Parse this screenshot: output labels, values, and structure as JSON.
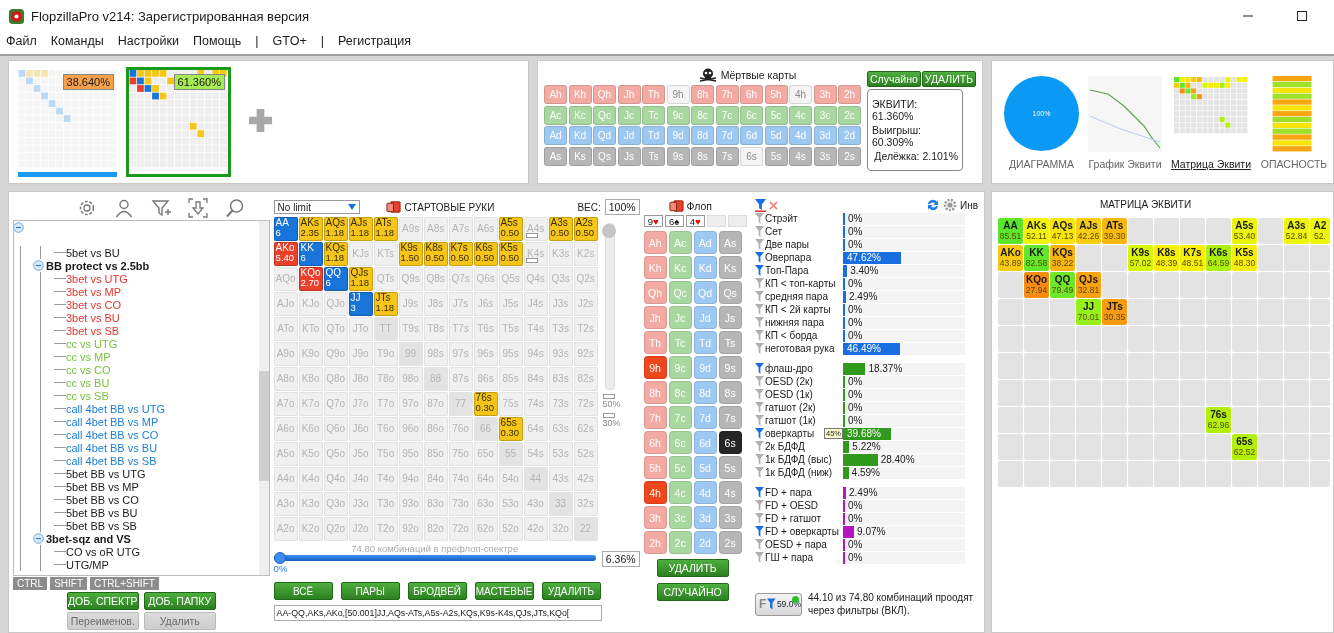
{
  "window": {
    "title": "FlopzillaPro v214: Зарегистрированная версия"
  },
  "menu": [
    "Файл",
    "Команды",
    "Настройки",
    "Помощь",
    "|",
    "GTO+",
    "|",
    "Регистрация"
  ],
  "ranges": [
    {
      "percent": "38.640%",
      "selected": false,
      "color": "#f7a04a"
    },
    {
      "percent": "61.360%",
      "selected": true,
      "color": "#a6ea55"
    }
  ],
  "dead_cards": {
    "title": "Мёртвые карты",
    "buttons": [
      "Случайно",
      "УДАЛИТЬ"
    ],
    "rows": [
      [
        {
          "label": "Ah",
          "disabled": false
        },
        {
          "label": "Kh",
          "disabled": false
        },
        {
          "label": "Qh",
          "disabled": false
        },
        {
          "label": "Jh",
          "disabled": false
        },
        {
          "label": "Th",
          "disabled": false
        },
        {
          "label": "9h",
          "disabled": true
        },
        {
          "label": "8h",
          "disabled": false
        },
        {
          "label": "7h",
          "disabled": false
        },
        {
          "label": "6h",
          "disabled": false
        },
        {
          "label": "5h",
          "disabled": false
        },
        {
          "label": "4h",
          "disabled": true
        },
        {
          "label": "3h",
          "disabled": false
        },
        {
          "label": "2h",
          "disabled": false
        }
      ],
      [
        {
          "label": "Ac",
          "disabled": false
        },
        {
          "label": "Kc",
          "disabled": false
        },
        {
          "label": "Qc",
          "disabled": false
        },
        {
          "label": "Jc",
          "disabled": false
        },
        {
          "label": "Tc",
          "disabled": false
        },
        {
          "label": "9c",
          "disabled": false
        },
        {
          "label": "8c",
          "disabled": false
        },
        {
          "label": "7c",
          "disabled": false
        },
        {
          "label": "6c",
          "disabled": false
        },
        {
          "label": "5c",
          "disabled": false
        },
        {
          "label": "4c",
          "disabled": false
        },
        {
          "label": "3c",
          "disabled": false
        },
        {
          "label": "2c",
          "disabled": false
        }
      ],
      [
        {
          "label": "Ad",
          "disabled": false
        },
        {
          "label": "Kd",
          "disabled": false
        },
        {
          "label": "Qd",
          "disabled": false
        },
        {
          "label": "Jd",
          "disabled": false
        },
        {
          "label": "Td",
          "disabled": false
        },
        {
          "label": "9d",
          "disabled": false
        },
        {
          "label": "8d",
          "disabled": false
        },
        {
          "label": "7d",
          "disabled": false
        },
        {
          "label": "6d",
          "disabled": false
        },
        {
          "label": "5d",
          "disabled": false
        },
        {
          "label": "4d",
          "disabled": false
        },
        {
          "label": "3d",
          "disabled": false
        },
        {
          "label": "2d",
          "disabled": false
        }
      ],
      [
        {
          "label": "As",
          "disabled": false
        },
        {
          "label": "Ks",
          "disabled": false
        },
        {
          "label": "Qs",
          "disabled": false
        },
        {
          "label": "Js",
          "disabled": false
        },
        {
          "label": "Ts",
          "disabled": false
        },
        {
          "label": "9s",
          "disabled": false
        },
        {
          "label": "8s",
          "disabled": false
        },
        {
          "label": "7s",
          "disabled": false
        },
        {
          "label": "6s",
          "disabled": true
        },
        {
          "label": "5s",
          "disabled": false
        },
        {
          "label": "4s",
          "disabled": false
        },
        {
          "label": "3s",
          "disabled": false
        },
        {
          "label": "2s",
          "disabled": false
        }
      ]
    ],
    "equity": [
      "ЭКВИТИ: 61.360%",
      "Выигрыш: 60.309%",
      "Делёжка: 2.101%"
    ]
  },
  "views": [
    {
      "kind": "pie",
      "label": "ДИАГРАММА",
      "text": "100%",
      "selected": false
    },
    {
      "kind": "line",
      "label": "График Эквити",
      "selected": false
    },
    {
      "kind": "matrix",
      "label": "Матрица Эквити",
      "selected": true
    },
    {
      "kind": "heat",
      "label": "ОПАСНОСТЬ",
      "selected": false
    }
  ],
  "tree": {
    "items": [
      {
        "expanded": true,
        "children": [
          {
            "expanded": true,
            "children": [
              {
                "label": "5bet vs BU",
                "color": "#1a1a1a"
              }
            ]
          },
          {
            "label": "BB protect vs 2.5bb",
            "expanded": true,
            "children": [
              {
                "label": "3bet vs UTG",
                "color": "#e8352e"
              },
              {
                "label": "3bet vs MP",
                "color": "#e8352e"
              },
              {
                "label": "3bet vs CO",
                "color": "#e8352e"
              },
              {
                "label": "3bet vs BU",
                "color": "#e8352e"
              },
              {
                "label": "3bet vs SB",
                "color": "#e8352e"
              },
              {
                "label": "cc vs UTG",
                "color": "#78c13a"
              },
              {
                "label": "cc vs MP",
                "color": "#78c13a"
              },
              {
                "label": "cc vs CO",
                "color": "#78c13a"
              },
              {
                "label": "cc vs BU",
                "color": "#78c13a"
              },
              {
                "label": "cc vs SB",
                "color": "#78c13a"
              },
              {
                "label": "call 4bet BB vs UTG",
                "color": "#1c7fd6"
              },
              {
                "label": "call 4bet BB vs MP",
                "color": "#1c7fd6"
              },
              {
                "label": "call 4bet BB vs CO",
                "color": "#1c7fd6"
              },
              {
                "label": "call 4bet BB vs BU",
                "color": "#1c7fd6"
              },
              {
                "label": "call 4bet BB vs SB",
                "color": "#1c7fd6"
              },
              {
                "label": "5bet BB vs UTG",
                "color": "#1a1a1a"
              },
              {
                "label": "5bet BB vs MP",
                "color": "#1a1a1a"
              },
              {
                "label": "5bet BB vs CO",
                "color": "#1a1a1a"
              },
              {
                "label": "5bet BB vs BU",
                "color": "#1a1a1a"
              },
              {
                "label": "5bet BB vs SB",
                "color": "#1a1a1a"
              }
            ]
          },
          {
            "label": "3bet-sqz and VS",
            "expanded": true,
            "children": [
              {
                "label": "CO vs oR UTG",
                "color": "#1a1a1a"
              },
              {
                "label": "UTG/MP",
                "color": "#1a1a1a"
              }
            ]
          }
        ]
      }
    ],
    "modifier_keys": [
      "CTRL",
      "SHIFT",
      "CTRL+SHIFT"
    ],
    "buttons": [
      {
        "label": "ДОБ. СПЕКТР",
        "disabled": false
      },
      {
        "label": "ДОБ. ПАПКУ",
        "disabled": false
      },
      {
        "label": "Переименов.",
        "disabled": true
      },
      {
        "label": "Удалить",
        "disabled": true
      }
    ]
  },
  "range_editor": {
    "game_type": "No limit",
    "title": "СТАРТОВЫЕ РУКИ",
    "weight_label": "ВЕС:",
    "weight": "100%",
    "weight_slider": {
      "level": 1
    },
    "marks": [
      "50%",
      "30%"
    ],
    "rows": [
      [
        {
          "hand": "AA",
          "weight": "6",
          "color": "#1874d8"
        },
        {
          "hand": "AKs",
          "weight": "2.35",
          "color": "#f5c518"
        },
        {
          "hand": "AQs",
          "weight": "1.18",
          "color": "#f5c518"
        },
        {
          "hand": "AJs",
          "weight": "1.18",
          "color": "#f5c518"
        },
        {
          "hand": "ATs",
          "weight": "1.18",
          "color": "#f5c518"
        },
        "A9s",
        "A8s",
        "A7s",
        "A6s",
        {
          "hand": "A5s",
          "weight": "0.50",
          "color": "#f5c518"
        },
        {
          "hand": "A4s",
          "marked": true
        },
        {
          "hand": "A3s",
          "weight": "0.50",
          "color": "#f5c518"
        },
        {
          "hand": "A2s",
          "weight": "0.50",
          "color": "#f5c518"
        }
      ],
      [
        {
          "hand": "AKo",
          "weight": "5.40",
          "color": "#e8402a"
        },
        {
          "hand": "KK",
          "weight": "6",
          "color": "#1874d8"
        },
        {
          "hand": "KQs",
          "weight": "1.18",
          "color": "#f5c518"
        },
        "KJs",
        "KTs",
        {
          "hand": "K9s",
          "weight": "1.50",
          "color": "#f5c518"
        },
        {
          "hand": "K8s",
          "weight": "0.50",
          "color": "#f5c518"
        },
        {
          "hand": "K7s",
          "weight": "0.50",
          "color": "#f5c518"
        },
        {
          "hand": "K6s",
          "weight": "0.50",
          "color": "#f5c518"
        },
        {
          "hand": "K5s",
          "weight": "0.50",
          "color": "#f5c518"
        },
        {
          "hand": "K4s",
          "marked": true
        },
        "K3s",
        "K2s"
      ],
      [
        "AQo",
        {
          "hand": "KQo",
          "weight": "2.70",
          "color": "#e8402a"
        },
        {
          "hand": "QQ",
          "weight": "6",
          "color": "#1874d8"
        },
        {
          "hand": "QJs",
          "weight": "1.18",
          "color": "#f5c518"
        },
        "QTs",
        "Q9s",
        "Q8s",
        "Q7s",
        "Q6s",
        "Q5s",
        "Q4s",
        "Q3s",
        "Q2s"
      ],
      [
        "AJo",
        "KJo",
        "QJo",
        {
          "hand": "JJ",
          "weight": "3",
          "color": "#1874d8"
        },
        {
          "hand": "JTs",
          "weight": "1.18",
          "color": "#f5c518"
        },
        "J9s",
        "J8s",
        "J7s",
        "J6s",
        "J5s",
        "J4s",
        "J3s",
        "J2s"
      ],
      [
        "ATo",
        "KTo",
        "QTo",
        "JTo",
        "TT",
        "T9s",
        "T8s",
        "T7s",
        "T6s",
        "T5s",
        "T4s",
        "T3s",
        "T2s"
      ],
      [
        "A9o",
        "K9o",
        "Q9o",
        "J9o",
        "T9o",
        "99",
        "98s",
        "97s",
        "96s",
        "95s",
        "94s",
        "93s",
        "92s"
      ],
      [
        "A8o",
        "K8o",
        "Q8o",
        "J8o",
        "T8o",
        "98o",
        "88",
        "87s",
        "86s",
        "85s",
        "84s",
        "83s",
        "82s"
      ],
      [
        "A7o",
        "K7o",
        "Q7o",
        "J7o",
        "T7o",
        "97o",
        "87o",
        "77",
        {
          "hand": "76s",
          "weight": "0.30",
          "color": "#f5c518"
        },
        "75s",
        "74s",
        "73s",
        "72s"
      ],
      [
        "A6o",
        "K6o",
        "Q6o",
        "J6o",
        "T6o",
        "96o",
        "86o",
        "76o",
        "66",
        {
          "hand": "65s",
          "weight": "0.30",
          "color": "#f5c518"
        },
        "64s",
        "63s",
        "62s"
      ],
      [
        "A5o",
        "K5o",
        "Q5o",
        "J5o",
        "T5o",
        "95o",
        "85o",
        "75o",
        "65o",
        "55",
        "54s",
        "53s",
        "52s"
      ],
      [
        "A4o",
        "K4o",
        "Q4o",
        "J4o",
        "T4o",
        "94o",
        "84o",
        "74o",
        "64o",
        "54o",
        "44",
        "43s",
        "42s"
      ],
      [
        "A3o",
        "K3o",
        "Q3o",
        "J3o",
        "T3o",
        "93o",
        "83o",
        "73o",
        "63o",
        "53o",
        "43o",
        "33",
        "32s"
      ],
      [
        "A2o",
        "K2o",
        "Q2o",
        "J2o",
        "T2o",
        "92o",
        "82o",
        "72o",
        "62o",
        "52o",
        "42o",
        "32o",
        "22"
      ]
    ],
    "combos": "74.80 комбинаций в префлоп-спектре",
    "percent_slider": {
      "level": 0
    },
    "percent_min": "0%",
    "percent": "6.36%",
    "buttons": [
      "ВСЁ",
      "ПАРЫ",
      "БРОДВЕЙ",
      "МАСТЕВЫЕ",
      "УДАЛИТЬ"
    ],
    "range_text": "AA-QQ,AKs,AKo,[50.001]JJ,AQs-ATs,A5s-A2s,KQs,K9s-K4s,QJs,JTs,KQo["
  },
  "board": {
    "title": "Флоп",
    "slots": [
      {
        "kind": "card",
        "rank": "9",
        "suit": "♥",
        "color": "#e01010"
      },
      {
        "kind": "card",
        "rank": "6",
        "suit": "♠",
        "color": "#111111"
      },
      {
        "kind": "card",
        "rank": "4",
        "suit": "♥",
        "color": "#e01010"
      },
      {
        "kind": "empty"
      },
      {
        "kind": "empty"
      }
    ],
    "rows": [
      [
        {
          "label": "Ah",
          "selected": false
        },
        {
          "label": "Ac",
          "selected": false
        },
        {
          "label": "Ad",
          "selected": false
        },
        {
          "label": "As",
          "selected": false
        }
      ],
      [
        {
          "label": "Kh",
          "selected": false
        },
        {
          "label": "Kc",
          "selected": false
        },
        {
          "label": "Kd",
          "selected": false
        },
        {
          "label": "Ks",
          "selected": false
        }
      ],
      [
        {
          "label": "Qh",
          "selected": false
        },
        {
          "label": "Qc",
          "selected": false
        },
        {
          "label": "Qd",
          "selected": false
        },
        {
          "label": "Qs",
          "selected": false
        }
      ],
      [
        {
          "label": "Jh",
          "selected": false
        },
        {
          "label": "Jc",
          "selected": false
        },
        {
          "label": "Jd",
          "selected": false
        },
        {
          "label": "Js",
          "selected": false
        }
      ],
      [
        {
          "label": "Th",
          "selected": false
        },
        {
          "label": "Tc",
          "selected": false
        },
        {
          "label": "Td",
          "selected": false
        },
        {
          "label": "Ts",
          "selected": false
        }
      ],
      [
        {
          "label": "9h",
          "selected": true
        },
        {
          "label": "9c",
          "selected": false
        },
        {
          "label": "9d",
          "selected": false
        },
        {
          "label": "9s",
          "selected": false
        }
      ],
      [
        {
          "label": "8h",
          "selected": false
        },
        {
          "label": "8c",
          "selected": false
        },
        {
          "label": "8d",
          "selected": false
        },
        {
          "label": "8s",
          "selected": false
        }
      ],
      [
        {
          "label": "7h",
          "selected": false
        },
        {
          "label": "7c",
          "selected": false
        },
        {
          "label": "7d",
          "selected": false
        },
        {
          "label": "7s",
          "selected": false
        }
      ],
      [
        {
          "label": "6h",
          "selected": false
        },
        {
          "label": "6c",
          "selected": false
        },
        {
          "label": "6d",
          "selected": false
        },
        {
          "label": "6s",
          "selected": true
        }
      ],
      [
        {
          "label": "5h",
          "selected": false
        },
        {
          "label": "5c",
          "selected": false
        },
        {
          "label": "5d",
          "selected": false
        },
        {
          "label": "5s",
          "selected": false
        }
      ],
      [
        {
          "label": "4h",
          "selected": true
        },
        {
          "label": "4c",
          "selected": false
        },
        {
          "label": "4d",
          "selected": false
        },
        {
          "label": "4s",
          "selected": false
        }
      ],
      [
        {
          "label": "3h",
          "selected": false
        },
        {
          "label": "3c",
          "selected": false
        },
        {
          "label": "3d",
          "selected": false
        },
        {
          "label": "3s",
          "selected": false
        }
      ],
      [
        {
          "label": "2h",
          "selected": false
        },
        {
          "label": "2c",
          "selected": false
        },
        {
          "label": "2d",
          "selected": false
        },
        {
          "label": "2s",
          "selected": false
        }
      ]
    ],
    "buttons": [
      "УДАЛИТЬ",
      "СЛУЧАЙНО"
    ]
  },
  "filters": {
    "inv_label": "Инв",
    "groups": [
      {
        "kind": "made",
        "items": [
          {
            "label": "Стрэйт",
            "active": false,
            "value": "0%",
            "level": 0
          },
          {
            "label": "Сет",
            "active": false,
            "value": "0%",
            "level": 0
          },
          {
            "label": "Две пары",
            "active": false,
            "value": "0%",
            "level": 0
          },
          {
            "label": "Оверпара",
            "active": true,
            "value": "47.62%",
            "level": 0.4762
          },
          {
            "label": "Топ-Пара",
            "active": true,
            "value": "3.40%",
            "level": 0.034
          },
          {
            "label": "КП < топ-карты",
            "active": false,
            "value": "0%",
            "level": 0
          },
          {
            "label": "средняя пара",
            "active": false,
            "value": "2.49%",
            "level": 0.0249
          },
          {
            "label": "КП < 2й карты",
            "active": false,
            "value": "0%",
            "level": 0
          },
          {
            "label": "нижняя пара",
            "active": false,
            "value": "0%",
            "level": 0
          },
          {
            "label": "КП < борда",
            "active": false,
            "value": "0%",
            "level": 0
          },
          {
            "label": "неготовая рука",
            "active": false,
            "value": "46.49%",
            "level": 0.4649
          }
        ]
      },
      {
        "kind": "draw",
        "items": [
          {
            "label": "флаш-дро",
            "active": true,
            "value": "18.37%",
            "level": 0.1837
          },
          {
            "label": "OESD (2к)",
            "active": false,
            "value": "0%",
            "level": 0
          },
          {
            "label": "OESD (1к)",
            "active": false,
            "value": "0%",
            "level": 0
          },
          {
            "label": "гатшот (2к)",
            "active": false,
            "value": "0%",
            "level": 0
          },
          {
            "label": "гатшот (1к)",
            "active": false,
            "value": "0%",
            "level": 0
          },
          {
            "label": "оверкарты",
            "active": true,
            "badge": "45%",
            "value": "39.68%",
            "level": 0.3968
          },
          {
            "label": "2к БДФД",
            "active": false,
            "value": "5.22%",
            "level": 0.0522
          },
          {
            "label": "1к БДФД (выс)",
            "active": false,
            "value": "28.40%",
            "level": 0.284
          },
          {
            "label": "1к БДФД (ниж)",
            "active": false,
            "value": "4.59%",
            "level": 0.0459
          }
        ]
      },
      {
        "kind": "combo",
        "items": [
          {
            "label": "FD + пара",
            "active": true,
            "value": "2.49%",
            "level": 0.0249
          },
          {
            "label": "FD + OESD",
            "active": false,
            "value": "0%",
            "level": 0
          },
          {
            "label": "FD + гатшот",
            "active": false,
            "value": "0%",
            "level": 0
          },
          {
            "label": "FD + оверкарты",
            "active": true,
            "value": "9.07%",
            "level": 0.0907
          },
          {
            "label": "OESD + пара",
            "active": false,
            "value": "0%",
            "level": 0
          },
          {
            "label": "ГШ + пара",
            "active": false,
            "value": "0%",
            "level": 0
          }
        ]
      }
    ],
    "summary_letter": "F",
    "summary_button": "59.0%",
    "summary": "44.10 из 74.80 комбинаций проодят через фильтры (ВКЛ)."
  },
  "equity_matrix": {
    "title": "МАТРИЦА ЭКВИТИ",
    "rows": [
      [
        {
          "kind": "hand",
          "hand": "AA",
          "equity": "85.51",
          "color": "#5ce62a"
        },
        {
          "kind": "hand",
          "hand": "AKs",
          "equity": "52.11",
          "color": "#f2f20a"
        },
        {
          "kind": "hand",
          "hand": "AQs",
          "equity": "47.13",
          "color": "#f7e40c"
        },
        {
          "kind": "hand",
          "hand": "AJs",
          "equity": "42.26",
          "color": "#f8cc12"
        },
        {
          "kind": "hand",
          "hand": "ATs",
          "equity": "39.30",
          "color": "#f8b812"
        },
        {
          "kind": "empty"
        },
        {
          "kind": "empty"
        },
        {
          "kind": "empty"
        },
        {
          "kind": "empty"
        },
        {
          "kind": "hand",
          "hand": "A5s",
          "equity": "53.40",
          "color": "#eaf50a"
        },
        {
          "kind": "empty"
        },
        {
          "kind": "hand",
          "hand": "A3s",
          "equity": "52.84",
          "color": "#eef50a"
        },
        {
          "kind": "hand",
          "hand": "A2",
          "equity": "52.",
          "color": "#eef50a"
        }
      ],
      [
        {
          "kind": "hand",
          "hand": "AKo",
          "equity": "43.89",
          "color": "#f8c812"
        },
        {
          "kind": "hand",
          "hand": "KK",
          "equity": "82.58",
          "color": "#62e62a"
        },
        {
          "kind": "hand",
          "hand": "KQs",
          "equity": "38.22",
          "color": "#f8b412"
        },
        {
          "kind": "empty"
        },
        {
          "kind": "empty"
        },
        {
          "kind": "hand",
          "hand": "K9s",
          "equity": "57.02",
          "color": "#d6f50a"
        },
        {
          "kind": "hand",
          "hand": "K8s",
          "equity": "48.39",
          "color": "#f5ee0a"
        },
        {
          "kind": "hand",
          "hand": "K7s",
          "equity": "48.51",
          "color": "#f5ee0a"
        },
        {
          "kind": "hand",
          "hand": "K6s",
          "equity": "64.59",
          "color": "#aaf00a"
        },
        {
          "kind": "hand",
          "hand": "K5s",
          "equity": "48.30",
          "color": "#f5ee0a"
        },
        {
          "kind": "empty"
        },
        {
          "kind": "empty"
        },
        {
          "kind": "empty"
        }
      ],
      [
        {
          "kind": "empty"
        },
        {
          "kind": "hand",
          "hand": "KQo",
          "equity": "27.94",
          "color": "#f88c12"
        },
        {
          "kind": "hand",
          "hand": "QQ",
          "equity": "79.49",
          "color": "#6ee62a"
        },
        {
          "kind": "hand",
          "hand": "QJs",
          "equity": "32.81",
          "color": "#f8a212"
        },
        {
          "kind": "empty"
        },
        {
          "kind": "empty"
        },
        {
          "kind": "empty"
        },
        {
          "kind": "empty"
        },
        {
          "kind": "empty"
        },
        {
          "kind": "empty"
        },
        {
          "kind": "empty"
        },
        {
          "kind": "empty"
        },
        {
          "kind": "empty"
        }
      ],
      [
        {
          "kind": "empty"
        },
        {
          "kind": "empty"
        },
        {
          "kind": "empty"
        },
        {
          "kind": "hand",
          "hand": "JJ",
          "equity": "70.01",
          "color": "#96f01a"
        },
        {
          "kind": "hand",
          "hand": "JTs",
          "equity": "30.35",
          "color": "#f89a12"
        },
        {
          "kind": "empty"
        },
        {
          "kind": "empty"
        },
        {
          "kind": "empty"
        },
        {
          "kind": "empty"
        },
        {
          "kind": "empty"
        },
        {
          "kind": "empty"
        },
        {
          "kind": "empty"
        },
        {
          "kind": "empty"
        }
      ],
      [
        {
          "kind": "empty"
        },
        {
          "kind": "empty"
        },
        {
          "kind": "empty"
        },
        {
          "kind": "empty"
        },
        {
          "kind": "empty"
        },
        {
          "kind": "empty"
        },
        {
          "kind": "empty"
        },
        {
          "kind": "empty"
        },
        {
          "kind": "empty"
        },
        {
          "kind": "empty"
        },
        {
          "kind": "empty"
        },
        {
          "kind": "empty"
        },
        {
          "kind": "empty"
        }
      ],
      [
        {
          "kind": "empty"
        },
        {
          "kind": "empty"
        },
        {
          "kind": "empty"
        },
        {
          "kind": "empty"
        },
        {
          "kind": "empty"
        },
        {
          "kind": "empty"
        },
        {
          "kind": "empty"
        },
        {
          "kind": "empty"
        },
        {
          "kind": "empty"
        },
        {
          "kind": "empty"
        },
        {
          "kind": "empty"
        },
        {
          "kind": "empty"
        },
        {
          "kind": "empty"
        }
      ],
      [
        {
          "kind": "empty"
        },
        {
          "kind": "empty"
        },
        {
          "kind": "empty"
        },
        {
          "kind": "empty"
        },
        {
          "kind": "empty"
        },
        {
          "kind": "empty"
        },
        {
          "kind": "empty"
        },
        {
          "kind": "empty"
        },
        {
          "kind": "empty"
        },
        {
          "kind": "empty"
        },
        {
          "kind": "empty"
        },
        {
          "kind": "empty"
        },
        {
          "kind": "empty"
        }
      ],
      [
        {
          "kind": "empty"
        },
        {
          "kind": "empty"
        },
        {
          "kind": "empty"
        },
        {
          "kind": "empty"
        },
        {
          "kind": "empty"
        },
        {
          "kind": "empty"
        },
        {
          "kind": "empty"
        },
        {
          "kind": "empty"
        },
        {
          "kind": "hand",
          "hand": "76s",
          "equity": "62.96",
          "color": "#b2f00a"
        },
        {
          "kind": "empty"
        },
        {
          "kind": "empty"
        },
        {
          "kind": "empty"
        },
        {
          "kind": "empty"
        }
      ],
      [
        {
          "kind": "empty"
        },
        {
          "kind": "empty"
        },
        {
          "kind": "empty"
        },
        {
          "kind": "empty"
        },
        {
          "kind": "empty"
        },
        {
          "kind": "empty"
        },
        {
          "kind": "empty"
        },
        {
          "kind": "empty"
        },
        {
          "kind": "empty"
        },
        {
          "kind": "hand",
          "hand": "65s",
          "equity": "62.52",
          "color": "#b2f00a"
        },
        {
          "kind": "empty"
        },
        {
          "kind": "empty"
        },
        {
          "kind": "empty"
        }
      ],
      [
        {
          "kind": "empty"
        },
        {
          "kind": "empty"
        },
        {
          "kind": "empty"
        },
        {
          "kind": "empty"
        },
        {
          "kind": "empty"
        },
        {
          "kind": "empty"
        },
        {
          "kind": "empty"
        },
        {
          "kind": "empty"
        },
        {
          "kind": "empty"
        },
        {
          "kind": "empty"
        },
        {
          "kind": "empty"
        },
        {
          "kind": "empty"
        },
        {
          "kind": "empty"
        }
      ]
    ]
  }
}
